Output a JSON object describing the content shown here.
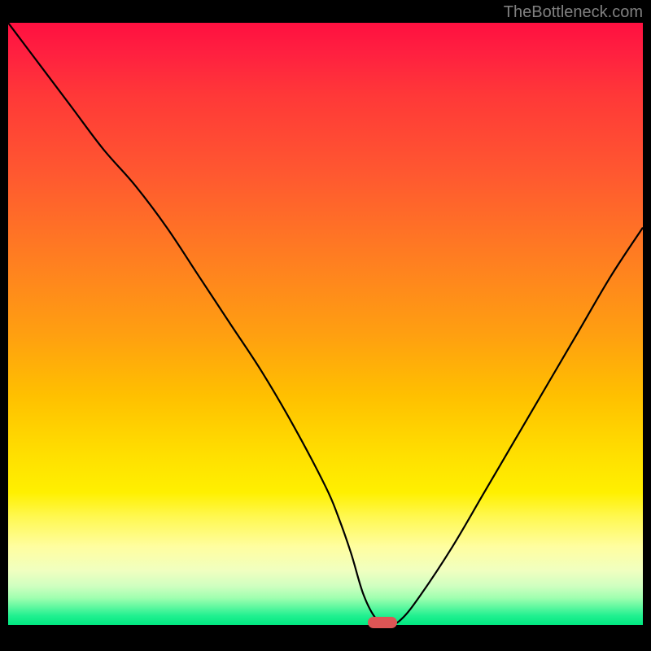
{
  "watermark": "TheBottleneck.com",
  "chart_data": {
    "type": "line",
    "title": "",
    "xlabel": "",
    "ylabel": "",
    "xlim": [
      0,
      100
    ],
    "ylim": [
      0,
      100
    ],
    "background_gradient": {
      "stops": [
        {
          "pos": 0,
          "color": "#ff1040"
        },
        {
          "pos": 0.05,
          "color": "#ff2040"
        },
        {
          "pos": 0.12,
          "color": "#ff3838"
        },
        {
          "pos": 0.25,
          "color": "#ff5830"
        },
        {
          "pos": 0.4,
          "color": "#ff8020"
        },
        {
          "pos": 0.52,
          "color": "#ffa010"
        },
        {
          "pos": 0.62,
          "color": "#ffc000"
        },
        {
          "pos": 0.72,
          "color": "#ffe000"
        },
        {
          "pos": 0.78,
          "color": "#fff000"
        },
        {
          "pos": 0.82,
          "color": "#fff850"
        },
        {
          "pos": 0.87,
          "color": "#fffea0"
        },
        {
          "pos": 0.91,
          "color": "#f0ffc0"
        },
        {
          "pos": 0.935,
          "color": "#d0ffc0"
        },
        {
          "pos": 0.955,
          "color": "#a0ffb0"
        },
        {
          "pos": 0.97,
          "color": "#60f8a0"
        },
        {
          "pos": 0.985,
          "color": "#20f090"
        },
        {
          "pos": 1.0,
          "color": "#00e880"
        }
      ]
    },
    "series": [
      {
        "name": "bottleneck-curve",
        "color": "#000000",
        "stroke_width": 2,
        "x": [
          0,
          5,
          10,
          15,
          20,
          25,
          30,
          35,
          40,
          45,
          50,
          52,
          54,
          56,
          58,
          60,
          62,
          65,
          70,
          75,
          80,
          85,
          90,
          95,
          100
        ],
        "y": [
          100,
          93,
          86,
          79,
          73,
          66,
          58,
          50,
          42,
          33,
          23,
          18,
          12,
          5,
          1,
          0,
          1,
          5,
          13,
          22,
          31,
          40,
          49,
          58,
          66
        ]
      }
    ],
    "marker": {
      "x": 59,
      "y": 0,
      "color": "#dd5555",
      "shape": "rounded-bar"
    }
  },
  "colors": {
    "frame": "#000000",
    "curve": "#000000",
    "marker": "#dd5555",
    "watermark": "#808080"
  }
}
